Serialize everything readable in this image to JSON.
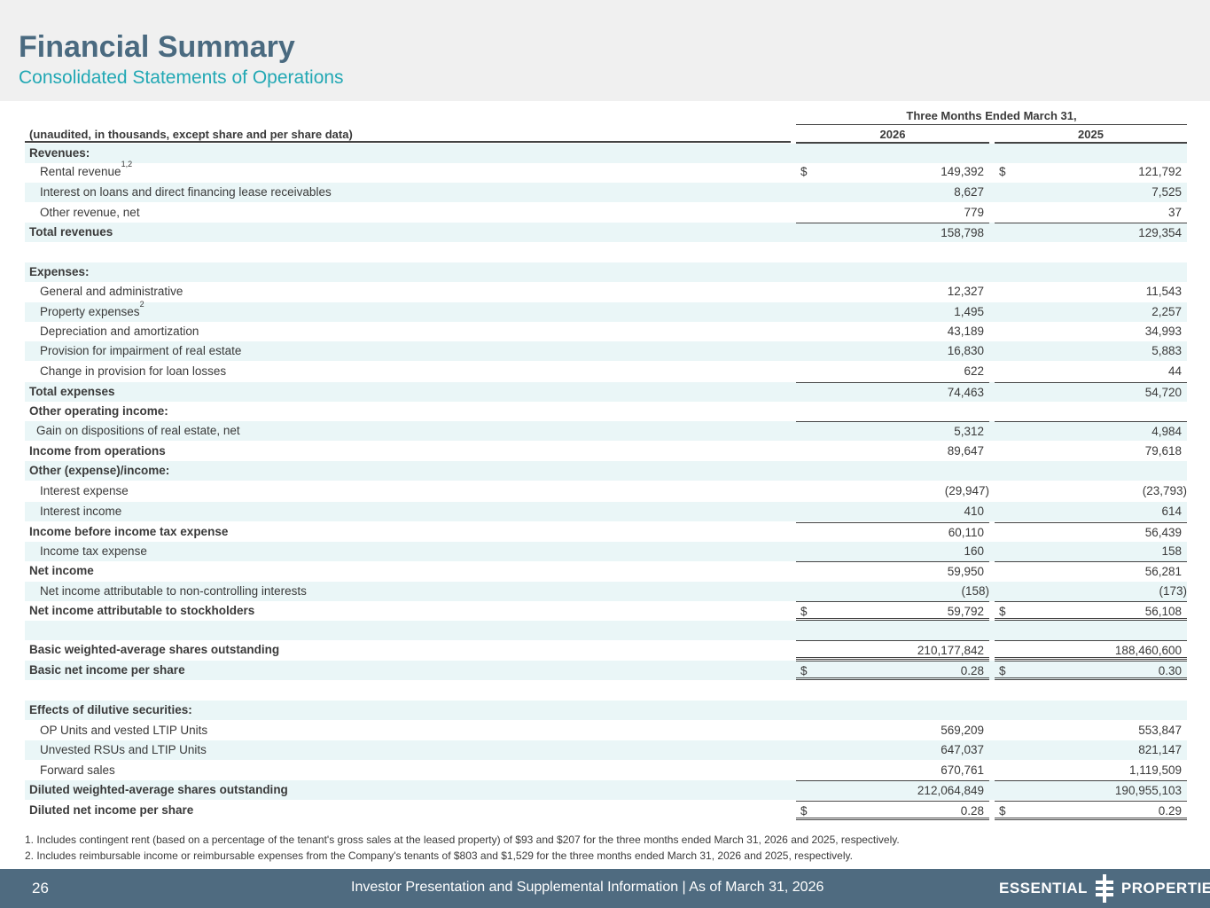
{
  "header": {
    "title": "Financial Summary",
    "subtitle": "Consolidated Statements of Operations"
  },
  "table": {
    "period_heading": "Three Months Ended March 31,",
    "note": "(unaudited, in thousands, except share and per share data)",
    "years": [
      "2026",
      "2025"
    ],
    "currency_symbol": "$",
    "rows": [
      {
        "label": "Revenues:"
      },
      {
        "label": "Rental revenue",
        "sup": "1,2",
        "v1": "149,392",
        "v2": "121,792"
      },
      {
        "label": "Interest on loans and direct financing lease receivables",
        "v1": "8,627",
        "v2": "7,525"
      },
      {
        "label": "Other revenue, net",
        "v1": "779",
        "v2": "37"
      },
      {
        "label": "Total revenues",
        "v1": "158,798",
        "v2": "129,354"
      },
      {
        "label": ""
      },
      {
        "label": "Expenses:"
      },
      {
        "label": "General and administrative",
        "v1": "12,327",
        "v2": "11,543"
      },
      {
        "label": "Property expenses",
        "sup": "2",
        "v1": "1,495",
        "v2": "2,257"
      },
      {
        "label": "Depreciation and amortization",
        "v1": "43,189",
        "v2": "34,993"
      },
      {
        "label": "Provision for impairment of real estate",
        "v1": "16,830",
        "v2": "5,883"
      },
      {
        "label": "Change in provision for loan losses",
        "v1": "622",
        "v2": "44"
      },
      {
        "label": "Total expenses",
        "v1": "74,463",
        "v2": "54,720"
      },
      {
        "label": "Other operating income:"
      },
      {
        "label": "Gain on dispositions of real estate, net",
        "v1": "5,312",
        "v2": "4,984"
      },
      {
        "label": "Income from operations",
        "v1": "89,647",
        "v2": "79,618"
      },
      {
        "label": "Other (expense)/income:"
      },
      {
        "label": "Interest expense",
        "v1": "(29,947)",
        "v2": "(23,793)"
      },
      {
        "label": "Interest income",
        "v1": "410",
        "v2": "614"
      },
      {
        "label": "Income before income tax expense",
        "v1": "60,110",
        "v2": "56,439"
      },
      {
        "label": "Income tax expense",
        "v1": "160",
        "v2": "158"
      },
      {
        "label": "Net income",
        "v1": "59,950",
        "v2": "56,281"
      },
      {
        "label": "Net income attributable to non-controlling interests",
        "v1": "(158)",
        "v2": "(173)"
      },
      {
        "label": "Net income attributable to stockholders",
        "v1": "59,792",
        "v2": "56,108"
      },
      {
        "label": ""
      },
      {
        "label": "Basic weighted-average shares outstanding",
        "v1": "210,177,842",
        "v2": "188,460,600"
      },
      {
        "label": "Basic net income per share",
        "v1": "0.28",
        "v2": "0.30"
      },
      {
        "label": ""
      },
      {
        "label": "Effects of dilutive securities:"
      },
      {
        "label": "OP Units and vested LTIP Units",
        "v1": "569,209",
        "v2": "553,847"
      },
      {
        "label": "Unvested RSUs and LTIP Units",
        "v1": "647,037",
        "v2": "821,147"
      },
      {
        "label": "Forward sales",
        "v1": "670,761",
        "v2": "1,119,509"
      },
      {
        "label": "Diluted weighted-average shares outstanding",
        "v1": "212,064,849",
        "v2": "190,955,103"
      },
      {
        "label": "Diluted net income per share",
        "v1": "0.28",
        "v2": "0.29"
      }
    ]
  },
  "footnotes": [
    "1. Includes contingent rent (based on a percentage of the tenant's gross sales at the leased property) of $93 and $207 for the three months ended March 31, 2026 and 2025, respectively.",
    "2. Includes reimbursable income or reimbursable expenses from the Company's tenants of $803 and $1,529 for the three months ended March 31, 2026 and 2025, respectively."
  ],
  "footer": {
    "page_number": "26",
    "text": "Investor Presentation and Supplemental Information |  As of March 31, 2026",
    "logo_left": "ESSENTIAL",
    "logo_right": "PROPERTIES"
  }
}
